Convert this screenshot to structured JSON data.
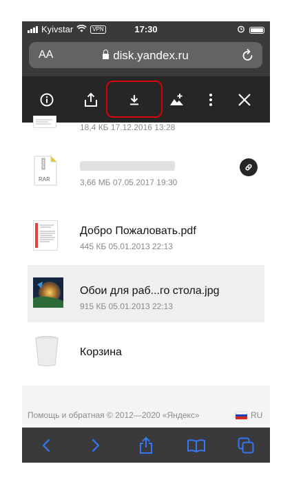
{
  "status": {
    "carrier": "Kyivstar",
    "vpn": "VPN",
    "time": "17:30"
  },
  "browser": {
    "text_size": "AA",
    "url": "disk.yandex.ru"
  },
  "files": [
    {
      "name": "",
      "meta": "18,4 КБ  17.12.2016  13:28"
    },
    {
      "name": "",
      "meta": "3,66 МБ  07.05.2017  19:30",
      "ext": "RAR"
    },
    {
      "name": "Добро Пожаловать.pdf",
      "meta": "445 КБ  05.01.2013  22:13"
    },
    {
      "name": "Обои для раб...го стола.jpg",
      "meta": "915 КБ  05.01.2013  22:13"
    },
    {
      "name": "Корзина",
      "meta": ""
    }
  ],
  "footer": {
    "text": "Помощь и обратная © 2012—2020  «Яндекс»",
    "lang": "RU"
  },
  "colors": {
    "accent_highlight": "#d9000f",
    "toolbar_bg": "#262626",
    "safari_bar": "#3a3a3c",
    "link_blue": "#3478f6"
  },
  "icons": [
    "info-icon",
    "share-icon",
    "download-icon",
    "add-image-icon",
    "more-icon",
    "close-icon",
    "link-icon",
    "back-icon",
    "forward-icon",
    "bookmarks-icon",
    "tabs-icon"
  ]
}
